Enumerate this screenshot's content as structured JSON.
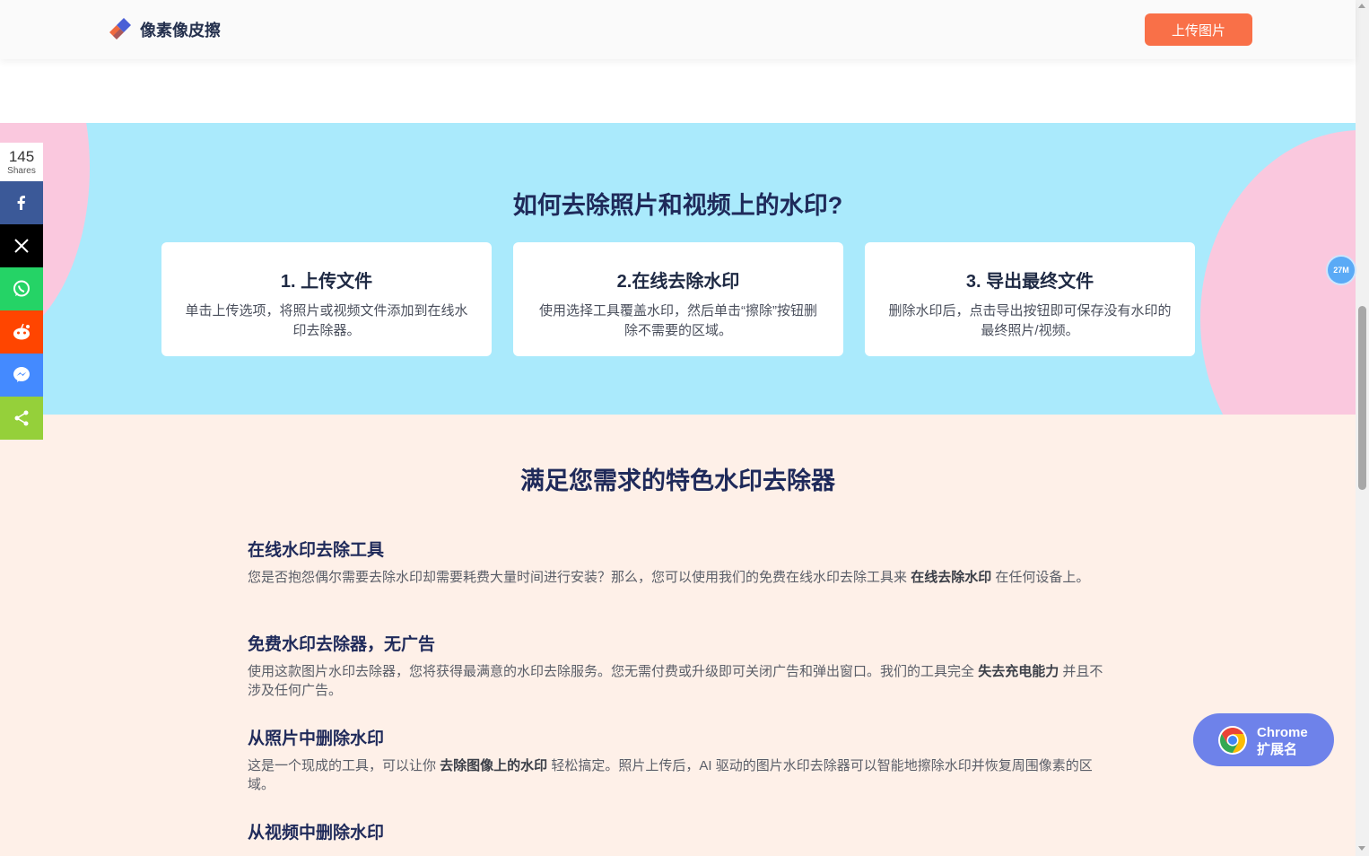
{
  "header": {
    "logo_text": "像素像皮擦",
    "upload_button": "上传图片"
  },
  "steps": {
    "title": "如何去除照片和视频上的水印?",
    "cards": [
      {
        "title": "1. 上传文件",
        "desc": "单击上传选项，将照片或视频文件添加到在线水印去除器。"
      },
      {
        "title": "2.在线去除水印",
        "desc": "使用选择工具覆盖水印，然后单击“擦除”按钮删除不需要的区域。"
      },
      {
        "title": "3. 导出最终文件",
        "desc": "删除水印后，点击导出按钮即可保存没有水印的最终照片/视频。"
      }
    ]
  },
  "features": {
    "title": "满足您需求的特色水印去除器",
    "items": [
      {
        "heading": "在线水印去除工具",
        "text_before": "您是否抱怨偶尔需要去除水印却需要耗费大量时间进行安装？那么，您可以使用我们的免费在线水印去除工具来 ",
        "bold": "在线去除水印",
        "text_after": " 在任何设备上。"
      },
      {
        "heading": "免费水印去除器，无广告",
        "text_before": "使用这款图片水印去除器，您将获得最满意的水印去除服务。您无需付费或升级即可关闭广告和弹出窗口。我们的工具完全 ",
        "bold": "失去充电能力",
        "text_after": " 并且不涉及任何广告。"
      },
      {
        "heading": "从照片中删除水印",
        "text_before": "这是一个现成的工具，可以让你 ",
        "bold": "去除图像上的水印",
        "text_after": " 轻松搞定。照片上传后，AI 驱动的图片水印去除器可以智能地擦除水印并恢复周围像素的区域。"
      },
      {
        "heading": "从视频中删除水印"
      }
    ]
  },
  "share": {
    "count": "145",
    "label": "Shares",
    "buttons": [
      {
        "name": "facebook",
        "color": "#3b5998"
      },
      {
        "name": "x",
        "color": "#000000"
      },
      {
        "name": "whatsapp",
        "color": "#25d366"
      },
      {
        "name": "reddit",
        "color": "#ff4500"
      },
      {
        "name": "messenger",
        "color": "#448aff"
      },
      {
        "name": "share",
        "color": "#95d03a"
      }
    ]
  },
  "widgets": {
    "memory_badge": "27M",
    "chrome_line1": "Chrome",
    "chrome_line2": "扩展名"
  },
  "colors": {
    "accent": "#f97048",
    "steps_bg": "#aaeafc",
    "blob_pink": "#fac8de",
    "features_bg": "#fef0e8",
    "heading": "#1f2a5a",
    "chrome_pill": "#6e82ea"
  }
}
